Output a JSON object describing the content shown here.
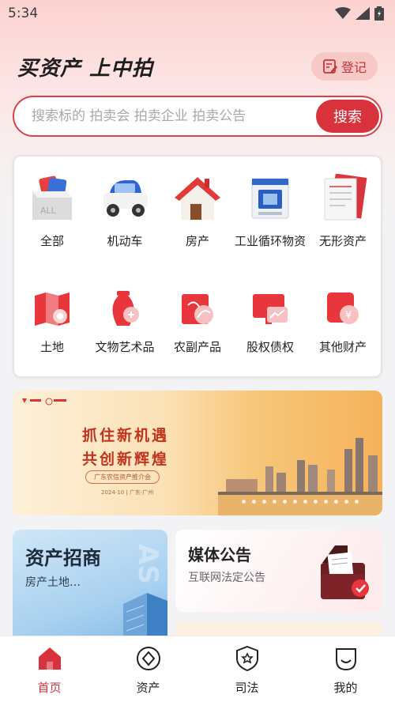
{
  "status_bar": {
    "time": "5:34"
  },
  "header": {
    "title": "买资产 上中拍",
    "register_label": "登记"
  },
  "search": {
    "placeholder": "搜索标的 拍卖会 拍卖企业 拍卖公告",
    "button_label": "搜索"
  },
  "categories": [
    {
      "label": "全部",
      "icon": "all-box-icon"
    },
    {
      "label": "机动车",
      "icon": "car-icon"
    },
    {
      "label": "房产",
      "icon": "house-icon"
    },
    {
      "label": "工业循环物资",
      "icon": "industrial-machine-icon"
    },
    {
      "label": "无形资产",
      "icon": "document-icon"
    },
    {
      "label": "土地",
      "icon": "land-map-icon"
    },
    {
      "label": "文物艺术品",
      "icon": "vase-icon"
    },
    {
      "label": "农副产品",
      "icon": "agriculture-icon"
    },
    {
      "label": "股权债权",
      "icon": "stock-chart-icon"
    },
    {
      "label": "其他财产",
      "icon": "other-property-icon"
    }
  ],
  "banner": {
    "slogan_line1": "抓住新机遇",
    "slogan_line2": "共创新辉煌",
    "pill_text": "广东农信资产推介会",
    "date_text": "2024-10 | 广东·广州"
  },
  "cards": {
    "asset_invest": {
      "title": "资产招商",
      "subtitle": "房产土地…"
    },
    "media": {
      "title": "媒体公告",
      "subtitle": "互联网法定公告"
    }
  },
  "bottom_nav": [
    {
      "label": "首页",
      "icon": "home-icon",
      "active": true
    },
    {
      "label": "资产",
      "icon": "asset-diamond-icon",
      "active": false
    },
    {
      "label": "司法",
      "icon": "justice-shield-icon",
      "active": false
    },
    {
      "label": "我的",
      "icon": "profile-icon",
      "active": false
    }
  ],
  "colors": {
    "accent": "#d8333c",
    "accent_light": "#f6c9c7",
    "page_bg": "#f3f3f5"
  }
}
